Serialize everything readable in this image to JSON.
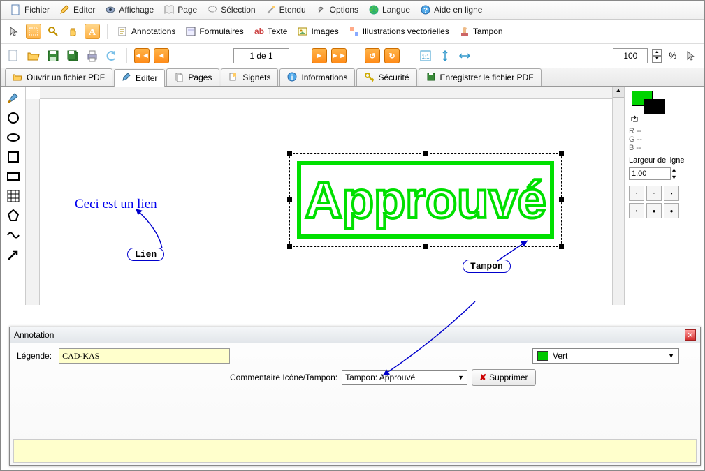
{
  "menubar": [
    {
      "id": "fichier",
      "label": "Fichier",
      "icon": "doc"
    },
    {
      "id": "editer",
      "label": "Editer",
      "icon": "pencil"
    },
    {
      "id": "affichage",
      "label": "Affichage",
      "icon": "eye"
    },
    {
      "id": "page",
      "label": "Page",
      "icon": "book"
    },
    {
      "id": "selection",
      "label": "Sélection",
      "icon": "lasso"
    },
    {
      "id": "etendu",
      "label": "Etendu",
      "icon": "wand"
    },
    {
      "id": "options",
      "label": "Options",
      "icon": "wrench"
    },
    {
      "id": "langue",
      "label": "Langue",
      "icon": "globe"
    },
    {
      "id": "aide",
      "label": "Aide en ligne",
      "icon": "help"
    }
  ],
  "toolbar1": {
    "modes": [
      "cursor",
      "rect",
      "zoom",
      "hand",
      "text"
    ],
    "groups": [
      {
        "id": "annotations",
        "label": "Annotations"
      },
      {
        "id": "formulaires",
        "label": "Formulaires"
      },
      {
        "id": "texte",
        "label": "Texte"
      },
      {
        "id": "images",
        "label": "Images"
      },
      {
        "id": "illustrations",
        "label": "Illustrations vectorielles"
      },
      {
        "id": "tampon",
        "label": "Tampon"
      }
    ]
  },
  "toolbar2": {
    "page_field": "1 de 1",
    "zoom_value": "100",
    "zoom_percent": "%"
  },
  "tabs": [
    {
      "id": "ouvrir",
      "label": "Ouvrir un fichier PDF",
      "icon": "open"
    },
    {
      "id": "editer",
      "label": "Editer",
      "icon": "edit",
      "active": true
    },
    {
      "id": "pages",
      "label": "Pages",
      "icon": "pages"
    },
    {
      "id": "signets",
      "label": "Signets",
      "icon": "bookmark"
    },
    {
      "id": "informations",
      "label": "Informations",
      "icon": "info"
    },
    {
      "id": "securite",
      "label": "Sécurité",
      "icon": "key"
    },
    {
      "id": "enregistrer",
      "label": "Enregistrer le fichier PDF",
      "icon": "save"
    }
  ],
  "canvas": {
    "link_text": "Ceci est un lien",
    "callout_lien": "Lien",
    "callout_tampon": "Tampon",
    "stamp_text": "Approuvé"
  },
  "rightpanel": {
    "r": "R --",
    "g": "G --",
    "b": "B --",
    "linewidth_label": "Largeur de ligne",
    "linewidth_value": "1.00"
  },
  "annotation": {
    "title": "Annotation",
    "legend_label": "Légende:",
    "legend_value": "CAD-KAS",
    "color_name": "Vert",
    "combo_label": "Commentaire Icône/Tampon:",
    "combo_value": "Tampon: Approuvé",
    "delete_label": "Supprimer"
  }
}
